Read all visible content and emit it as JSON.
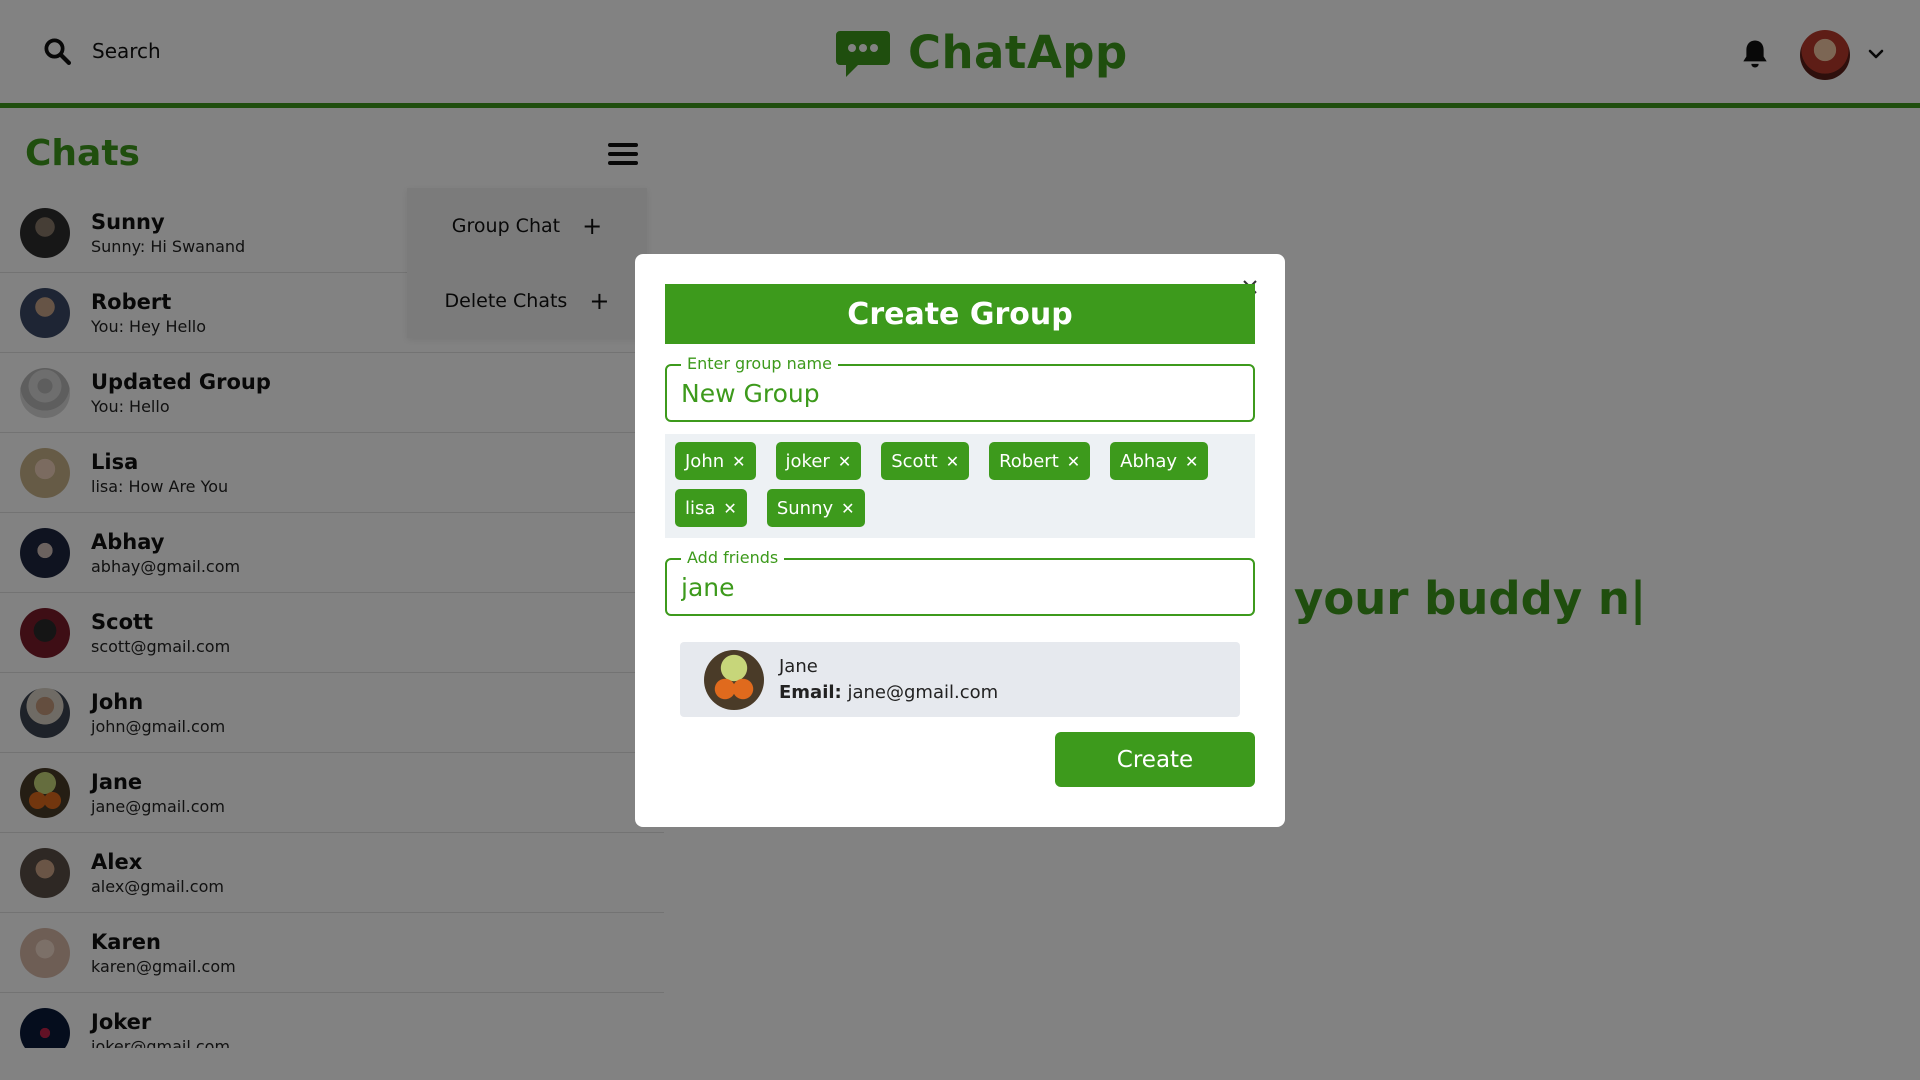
{
  "header": {
    "search_label": "Search",
    "brand_title": "ChatApp"
  },
  "sidebar": {
    "title": "Chats",
    "chats": [
      {
        "name": "Sunny",
        "sub": "Sunny: Hi Swanand",
        "avatar_color": "#2e2e2e"
      },
      {
        "name": "Robert",
        "sub": "You: Hey Hello",
        "avatar_color": "#3b4a66"
      },
      {
        "name": "Updated Group",
        "sub": "You: Hello",
        "avatar_color": "#d5d5d5"
      },
      {
        "name": "Lisa",
        "sub": "lisa: How Are You",
        "avatar_color": "#c9b38a"
      },
      {
        "name": "Abhay",
        "sub": "abhay@gmail.com",
        "avatar_color": "#1f2740"
      },
      {
        "name": "Scott",
        "sub": "scott@gmail.com",
        "avatar_color": "#7a1c2a"
      },
      {
        "name": "John",
        "sub": "john@gmail.com",
        "avatar_color": "#6b5846"
      },
      {
        "name": "Jane",
        "sub": "jane@gmail.com",
        "avatar_color": "#7a4a1c"
      },
      {
        "name": "Alex",
        "sub": "alex@gmail.com",
        "avatar_color": "#5a5048"
      },
      {
        "name": "Karen",
        "sub": "karen@gmail.com",
        "avatar_color": "#d7b8a8"
      },
      {
        "name": "Joker",
        "sub": "joker@gmail.com",
        "avatar_color": "#0b1a3a"
      }
    ],
    "dropdown": {
      "group_chat": "Group Chat",
      "delete_chats": "Delete Chats"
    }
  },
  "main": {
    "placeholder": "your buddy n|"
  },
  "modal": {
    "title": "Create Group",
    "group_name_label": "Enter group name",
    "group_name_value": "New Group",
    "chips": [
      "John",
      "joker",
      "Scott",
      "Robert",
      "Abhay",
      "lisa",
      "Sunny"
    ],
    "add_friends_label": "Add friends",
    "add_friends_value": "jane",
    "result": {
      "name": "Jane",
      "email_label": "Email:",
      "email": "jane@gmail.com"
    },
    "create_label": "Create"
  },
  "colors": {
    "accent": "#3d9a1c",
    "overlay": "rgba(0,0,0,0.49)"
  }
}
